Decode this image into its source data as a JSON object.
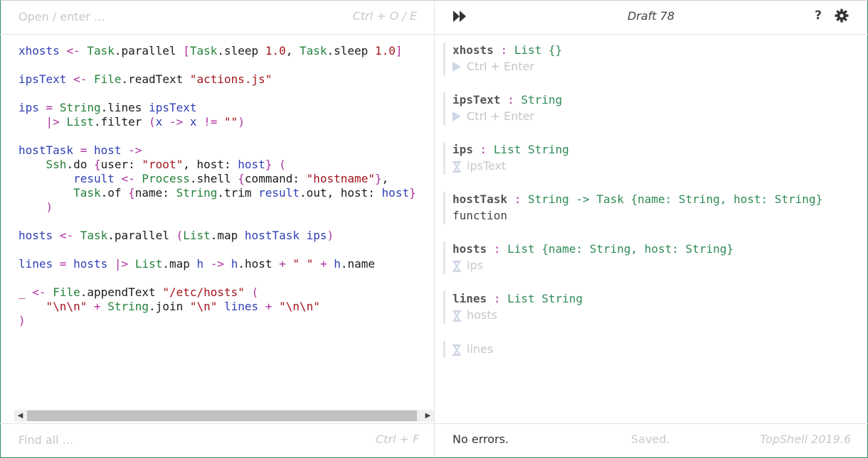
{
  "top_left": {
    "open_placeholder": "Open / enter ...",
    "open_shortcut": "Ctrl + O / E"
  },
  "top_right": {
    "draft_title": "Draft 78",
    "help_label": "?"
  },
  "editor": {
    "code_lines": [
      [
        [
          "kw",
          "xhosts"
        ],
        [
          "p",
          " "
        ],
        [
          "op",
          "<-"
        ],
        [
          "p",
          " "
        ],
        [
          "mod",
          "Task"
        ],
        [
          "p",
          ".parallel "
        ],
        [
          "br",
          "["
        ],
        [
          "mod",
          "Task"
        ],
        [
          "p",
          ".sleep "
        ],
        [
          "num",
          "1.0"
        ],
        [
          "p",
          ", "
        ],
        [
          "mod",
          "Task"
        ],
        [
          "p",
          ".sleep "
        ],
        [
          "num",
          "1.0"
        ],
        [
          "br",
          "]"
        ]
      ],
      [],
      [
        [
          "kw",
          "ipsText"
        ],
        [
          "p",
          " "
        ],
        [
          "op",
          "<-"
        ],
        [
          "p",
          " "
        ],
        [
          "mod",
          "File"
        ],
        [
          "p",
          ".readText "
        ],
        [
          "str",
          "\"actions.js\""
        ]
      ],
      [],
      [
        [
          "kw",
          "ips"
        ],
        [
          "p",
          " "
        ],
        [
          "op",
          "="
        ],
        [
          "p",
          " "
        ],
        [
          "mod",
          "String"
        ],
        [
          "p",
          ".lines "
        ],
        [
          "kw",
          "ipsText"
        ]
      ],
      [
        [
          "p",
          "    "
        ],
        [
          "op",
          "|>"
        ],
        [
          "p",
          " "
        ],
        [
          "mod",
          "List"
        ],
        [
          "p",
          ".filter "
        ],
        [
          "br",
          "("
        ],
        [
          "kw",
          "x"
        ],
        [
          "p",
          " "
        ],
        [
          "op",
          "->"
        ],
        [
          "p",
          " "
        ],
        [
          "kw",
          "x"
        ],
        [
          "p",
          " "
        ],
        [
          "op",
          "!="
        ],
        [
          "p",
          " "
        ],
        [
          "str",
          "\"\""
        ],
        [
          "br",
          ")"
        ]
      ],
      [],
      [
        [
          "kw",
          "hostTask"
        ],
        [
          "p",
          " "
        ],
        [
          "op",
          "="
        ],
        [
          "p",
          " "
        ],
        [
          "kw",
          "host"
        ],
        [
          "p",
          " "
        ],
        [
          "op",
          "->"
        ]
      ],
      [
        [
          "p",
          "    "
        ],
        [
          "mod",
          "Ssh"
        ],
        [
          "p",
          ".do "
        ],
        [
          "br",
          "{"
        ],
        [
          "p",
          "user: "
        ],
        [
          "str",
          "\"root\""
        ],
        [
          "p",
          ", host: "
        ],
        [
          "kw",
          "host"
        ],
        [
          "br",
          "}"
        ],
        [
          "p",
          " "
        ],
        [
          "br",
          "("
        ]
      ],
      [
        [
          "p",
          "        "
        ],
        [
          "kw",
          "result"
        ],
        [
          "p",
          " "
        ],
        [
          "op",
          "<-"
        ],
        [
          "p",
          " "
        ],
        [
          "mod",
          "Process"
        ],
        [
          "p",
          ".shell "
        ],
        [
          "br",
          "{"
        ],
        [
          "p",
          "command: "
        ],
        [
          "str",
          "\"hostname\""
        ],
        [
          "br",
          "}"
        ],
        [
          "p",
          ","
        ]
      ],
      [
        [
          "p",
          "        "
        ],
        [
          "mod",
          "Task"
        ],
        [
          "p",
          ".of "
        ],
        [
          "br",
          "{"
        ],
        [
          "p",
          "name: "
        ],
        [
          "mod",
          "String"
        ],
        [
          "p",
          ".trim "
        ],
        [
          "kw",
          "result"
        ],
        [
          "p",
          ".out, host: "
        ],
        [
          "kw",
          "host"
        ],
        [
          "br",
          "}"
        ]
      ],
      [
        [
          "p",
          "    "
        ],
        [
          "br",
          ")"
        ]
      ],
      [],
      [
        [
          "kw",
          "hosts"
        ],
        [
          "p",
          " "
        ],
        [
          "op",
          "<-"
        ],
        [
          "p",
          " "
        ],
        [
          "mod",
          "Task"
        ],
        [
          "p",
          ".parallel "
        ],
        [
          "br",
          "("
        ],
        [
          "mod",
          "List"
        ],
        [
          "p",
          ".map "
        ],
        [
          "kw",
          "hostTask"
        ],
        [
          "p",
          " "
        ],
        [
          "kw",
          "ips"
        ],
        [
          "br",
          ")"
        ]
      ],
      [],
      [
        [
          "kw",
          "lines"
        ],
        [
          "p",
          " "
        ],
        [
          "op",
          "="
        ],
        [
          "p",
          " "
        ],
        [
          "kw",
          "hosts"
        ],
        [
          "p",
          " "
        ],
        [
          "op",
          "|>"
        ],
        [
          "p",
          " "
        ],
        [
          "mod",
          "List"
        ],
        [
          "p",
          ".map "
        ],
        [
          "kw",
          "h"
        ],
        [
          "p",
          " "
        ],
        [
          "op",
          "->"
        ],
        [
          "p",
          " "
        ],
        [
          "kw",
          "h"
        ],
        [
          "p",
          ".host "
        ],
        [
          "op",
          "+"
        ],
        [
          "p",
          " "
        ],
        [
          "str",
          "\" \""
        ],
        [
          "p",
          " "
        ],
        [
          "op",
          "+"
        ],
        [
          "p",
          " "
        ],
        [
          "kw",
          "h"
        ],
        [
          "p",
          ".name"
        ]
      ],
      [],
      [
        [
          "str",
          "_"
        ],
        [
          "p",
          " "
        ],
        [
          "op",
          "<-"
        ],
        [
          "p",
          " "
        ],
        [
          "mod",
          "File"
        ],
        [
          "p",
          ".appendText "
        ],
        [
          "str",
          "\"/etc/hosts\""
        ],
        [
          "p",
          " "
        ],
        [
          "br",
          "("
        ]
      ],
      [
        [
          "p",
          "    "
        ],
        [
          "str",
          "\"\\n\\n\""
        ],
        [
          "p",
          " "
        ],
        [
          "op",
          "+"
        ],
        [
          "p",
          " "
        ],
        [
          "mod",
          "String"
        ],
        [
          "p",
          ".join "
        ],
        [
          "str",
          "\"\\n\""
        ],
        [
          "p",
          " "
        ],
        [
          "kw",
          "lines"
        ],
        [
          "p",
          " "
        ],
        [
          "op",
          "+"
        ],
        [
          "p",
          " "
        ],
        [
          "str",
          "\"\\n\\n\""
        ]
      ],
      [
        [
          "br",
          ")"
        ]
      ]
    ]
  },
  "find": {
    "placeholder": "Find all ...",
    "shortcut": "Ctrl + F"
  },
  "results": {
    "entries": [
      {
        "name": "xhosts",
        "colon": ":",
        "type": "List {}",
        "value_kind": "play",
        "value": "Ctrl + Enter"
      },
      {
        "name": "ipsText",
        "colon": ":",
        "type": "String",
        "value_kind": "play",
        "value": "Ctrl + Enter"
      },
      {
        "name": "ips",
        "colon": ":",
        "type": "List String",
        "value_kind": "wait",
        "value": "ipsText"
      },
      {
        "name": "hostTask",
        "colon": ":",
        "type": "String -> Task {name: String, host: String}",
        "value_kind": "code",
        "value": "function"
      },
      {
        "name": "hosts",
        "colon": ":",
        "type": "List {name: String, host: String}",
        "value_kind": "wait",
        "value": "ips"
      },
      {
        "name": "lines",
        "colon": ":",
        "type": "List String",
        "value_kind": "wait",
        "value": "hosts"
      },
      {
        "name": "",
        "colon": "",
        "type": "",
        "value_kind": "wait",
        "value": "lines"
      }
    ]
  },
  "status": {
    "errors": "No errors.",
    "saved": "Saved.",
    "version": "TopShell 2019.6"
  },
  "colors": {
    "keyword": "#2f3fb5",
    "operator": "#b0309e",
    "module": "#23823a",
    "string": "#a3151c",
    "type": "#2e8b57",
    "frame_accent": "#2b8a5a"
  }
}
